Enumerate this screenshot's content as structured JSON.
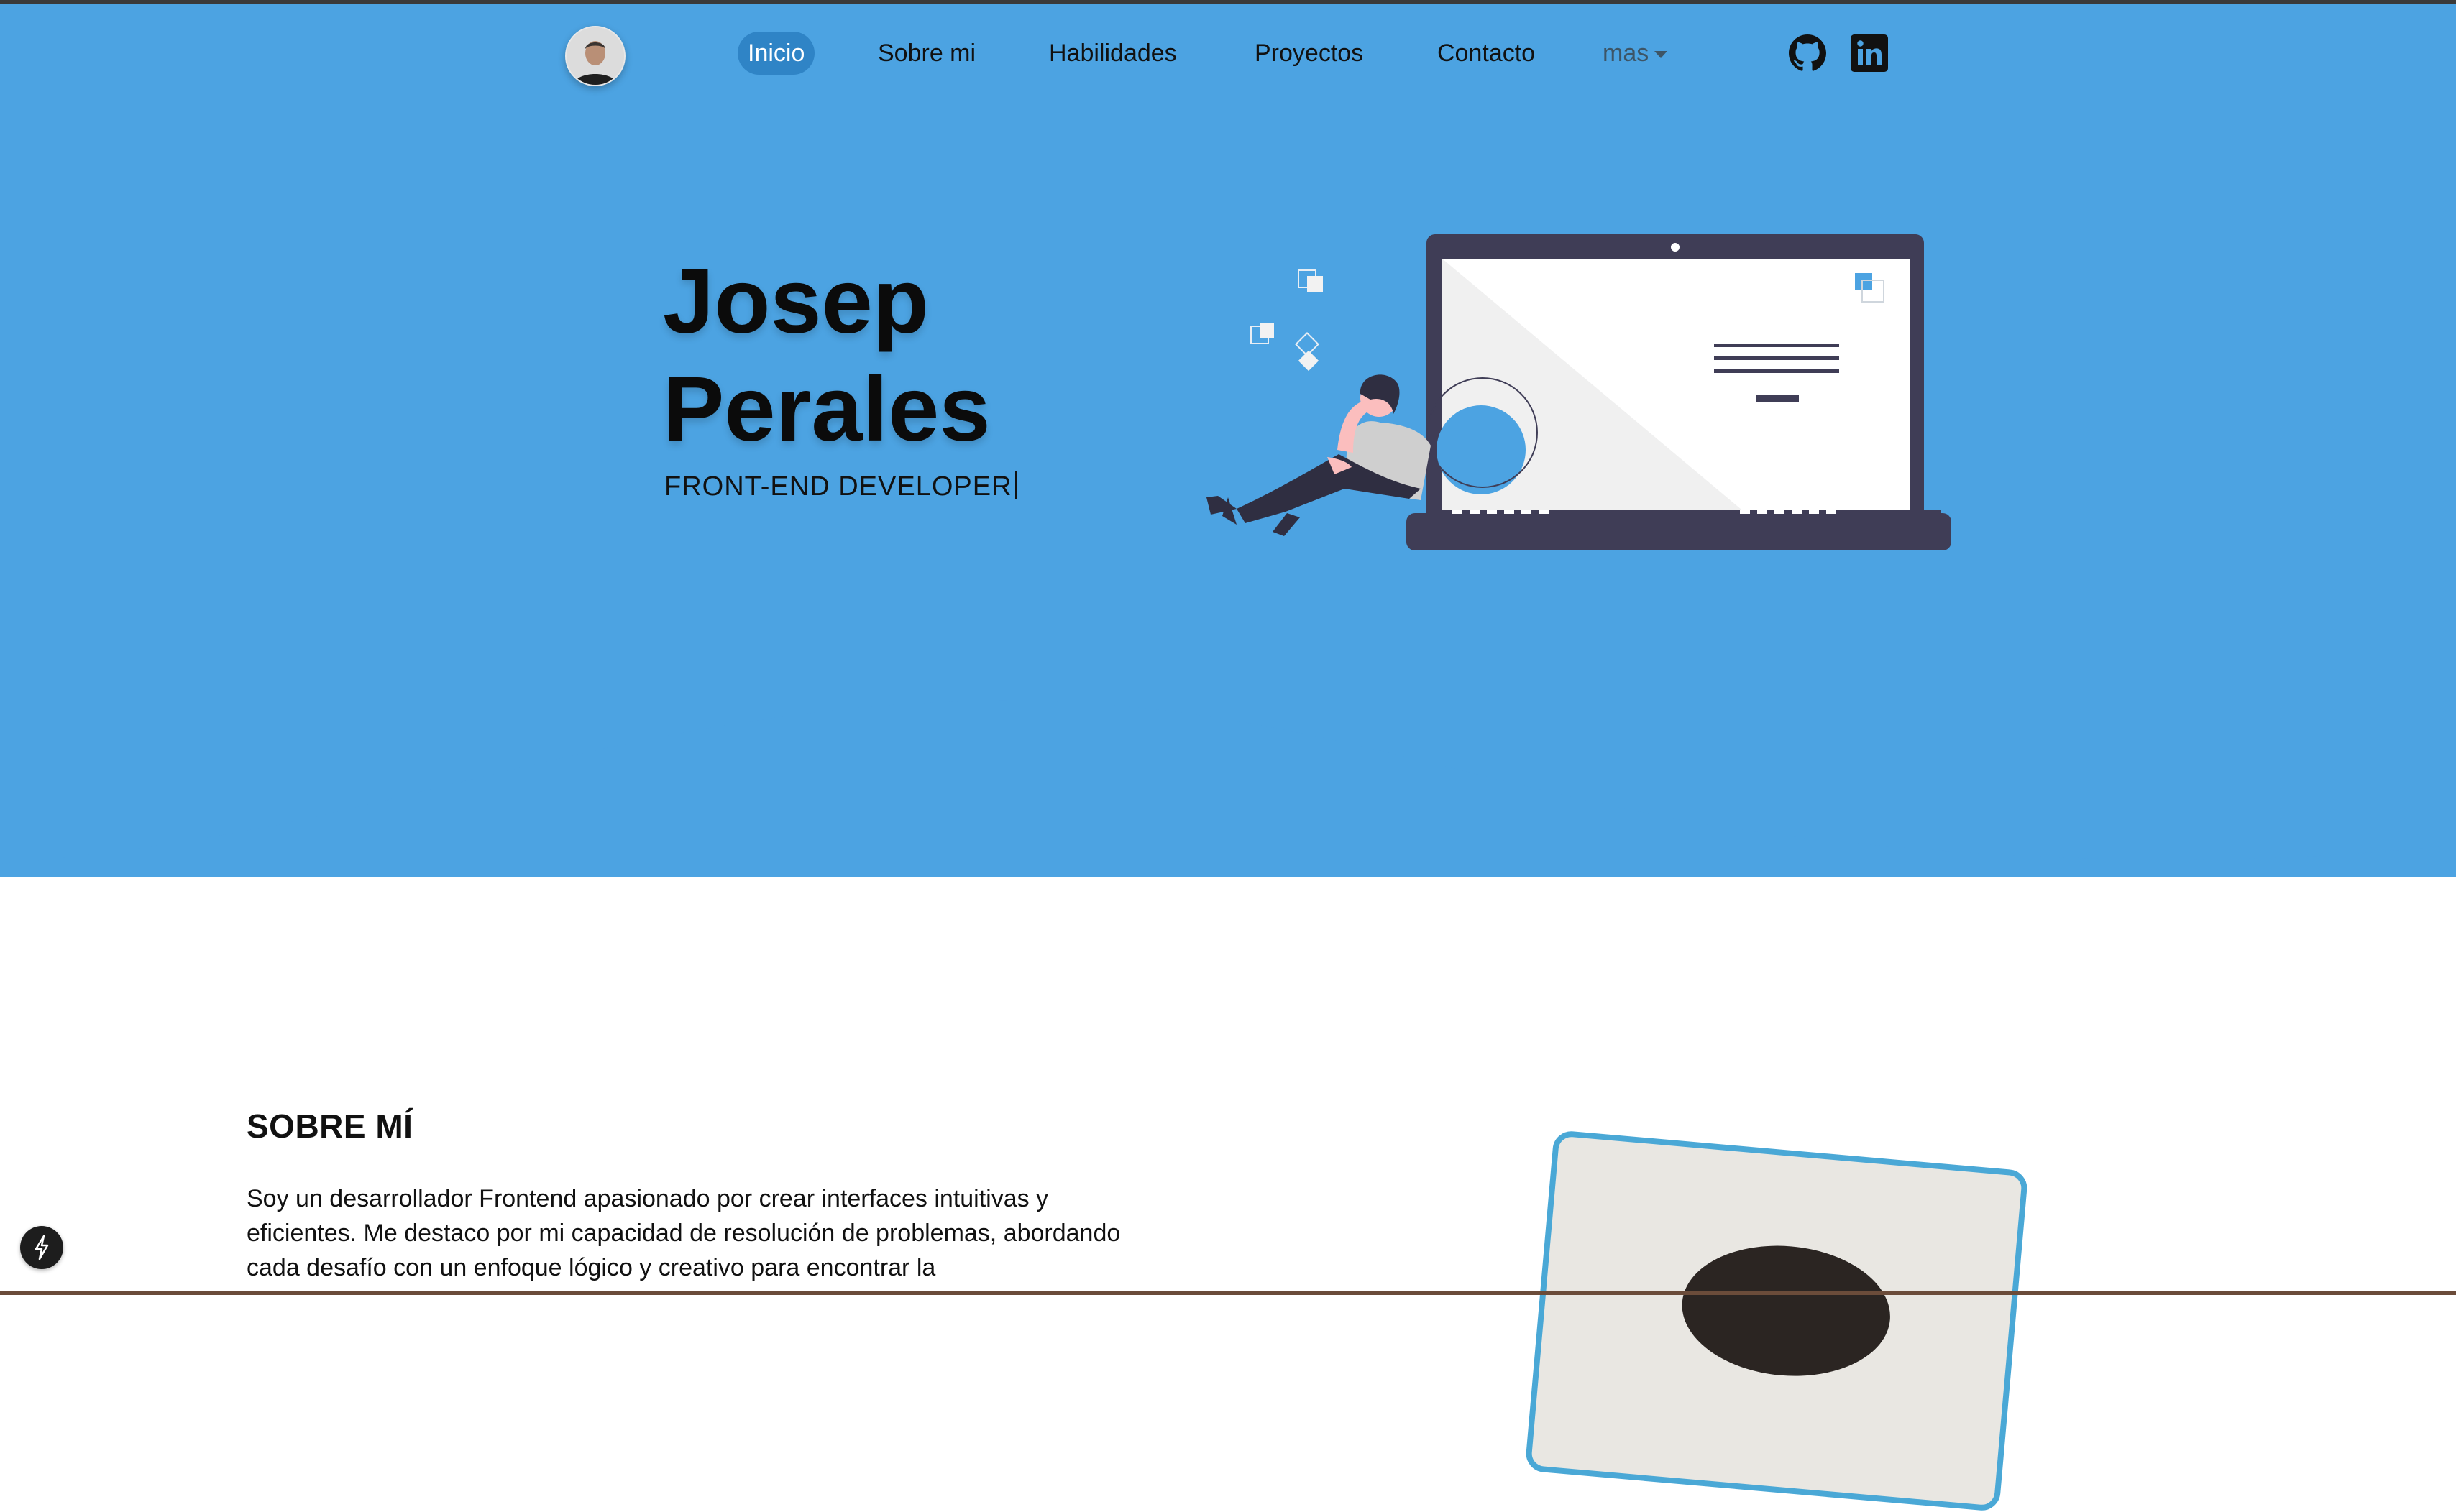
{
  "nav": {
    "items": [
      {
        "label": "Inicio",
        "active": true
      },
      {
        "label": "Sobre mi",
        "active": false
      },
      {
        "label": "Habilidades",
        "active": false
      },
      {
        "label": "Proyectos",
        "active": false
      },
      {
        "label": "Contacto",
        "active": false
      }
    ],
    "more_label": "mas",
    "social": [
      "github-icon",
      "linkedin-icon"
    ]
  },
  "hero": {
    "first_name": "Josep",
    "last_name": "Perales",
    "role": "FRONT-END DEVELOPER"
  },
  "about": {
    "title": "SOBRE MÍ",
    "text": "Soy un desarrollador Frontend apasionado por crear interfaces intuitivas y eficientes. Me destaco por mi capacidad de resolución de problemas, abordando cada desafío con un enfoque lógico y creativo para encontrar la"
  },
  "colors": {
    "hero_bg": "#4ca3e2",
    "active_pill": "#2f84c6",
    "photo_border": "#4aa8d6",
    "laptop": "#3f3d56"
  }
}
